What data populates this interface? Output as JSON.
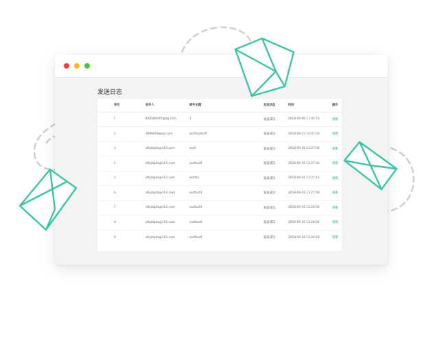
{
  "page_title": "发送日志",
  "window_controls": {
    "close": "red-dot",
    "minimize": "yellow-dot",
    "maximize": "green-dot"
  },
  "accent_color": "#3cc4a4",
  "table": {
    "headers": [
      "序号",
      "收件人",
      "邮件主题",
      "发送状态",
      "时间",
      "操作"
    ],
    "rows": [
      {
        "no": "1",
        "recipient": "450580045@qq.com",
        "subject": "1",
        "status": "发送成功",
        "time": "2018-09-06 17:05:53",
        "action": "查看"
      },
      {
        "no": "2",
        "recipient": "3096059@qq.com",
        "subject": "asdfasdasdf",
        "status": "发送成功",
        "time": "2018-09-23 14:47:03",
        "action": "查看"
      },
      {
        "no": "3",
        "recipient": "afkjdajda@163.com",
        "subject": "asdf",
        "status": "发送成功",
        "time": "2018-09-16 13:27:58",
        "action": "查看"
      },
      {
        "no": "4",
        "recipient": "afkjdajda@163.com",
        "subject": "asdfasdf",
        "status": "发送成功",
        "time": "2018-09-16 13:27:33",
        "action": "查看"
      },
      {
        "no": "5",
        "recipient": "afkjdajda@163.com",
        "subject": "asdfsa",
        "status": "发送成功",
        "time": "2018-09-16 13:27:15",
        "action": "查看"
      },
      {
        "no": "6",
        "recipient": "afkjdajda@163.com",
        "subject": "asdfasfd",
        "status": "发送成功",
        "time": "2018-09-16 13:27:09",
        "action": "查看"
      },
      {
        "no": "7",
        "recipient": "afkjdajda@163.com",
        "subject": "asdfasfd",
        "status": "发送成功",
        "time": "2018-09-16 13:26:59",
        "action": "查看"
      },
      {
        "no": "8",
        "recipient": "afkjdajda@163.com",
        "subject": "sadfasdf",
        "status": "发送成功",
        "time": "2018-09-16 13:26:54",
        "action": "查看"
      },
      {
        "no": "9",
        "recipient": "afkjdajda@163.com",
        "subject": "asdfasdf",
        "status": "发送成功",
        "time": "2018-09-16 13:24:29",
        "action": "查看"
      }
    ]
  }
}
